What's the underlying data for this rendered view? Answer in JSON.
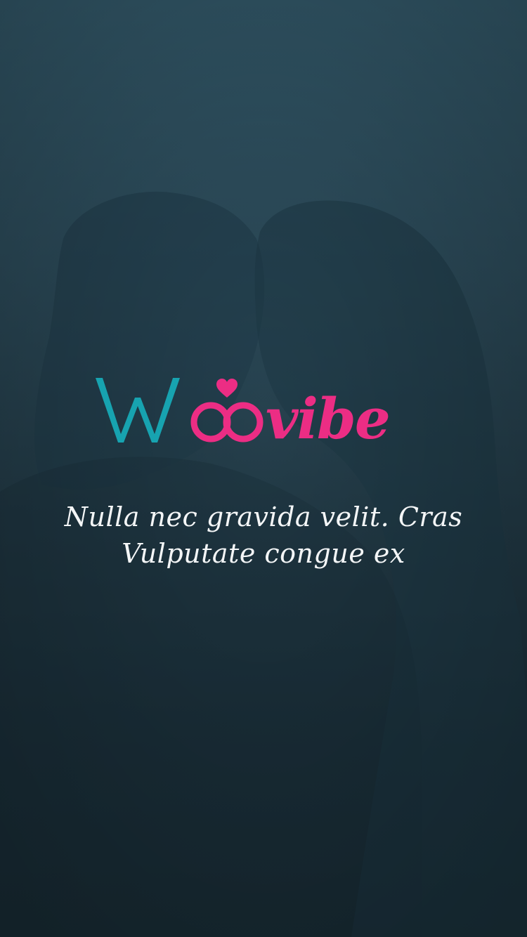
{
  "app": {
    "brand_wordmark": "Woovibe",
    "tagline": "Nulla nec gravida velit. Cras Vulputate congue ex"
  },
  "colors": {
    "background_top": "#33596a",
    "background_bottom": "#172830",
    "brand_teal": "#17a3b0",
    "brand_pink": "#ec2d84",
    "text": "#f4f6f7"
  },
  "icons": {
    "logo": "woovibe-logo-icon",
    "rings": "interlocked-rings-icon",
    "heart": "heart-icon"
  }
}
